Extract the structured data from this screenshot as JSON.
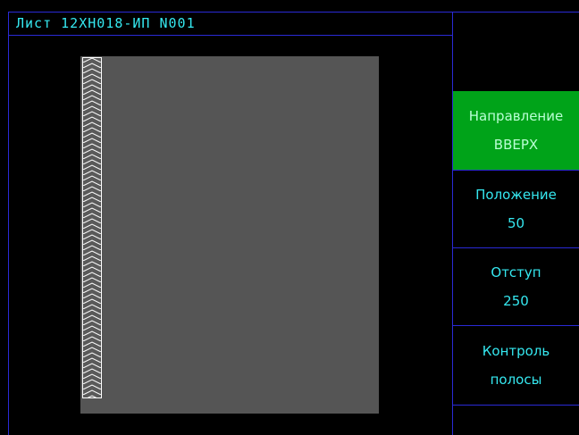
{
  "window": {
    "title": "Лист 12ХН018-ИП N001"
  },
  "colors": {
    "background": "#000000",
    "divider": "#2a2ad6",
    "text": "#35e8f0",
    "active_button": "#00a319",
    "sheet": "#555555"
  },
  "side_panel": {
    "direction": {
      "label": "Направление",
      "value": "ВВЕРХ",
      "active": true
    },
    "position": {
      "label": "Положение",
      "value": "50"
    },
    "offset": {
      "label": "Отступ",
      "value": "250"
    },
    "strip_control": {
      "label_line1": "Контроль",
      "label_line2": "полосы"
    }
  },
  "strip_icon": "chevron-hatch-pattern"
}
